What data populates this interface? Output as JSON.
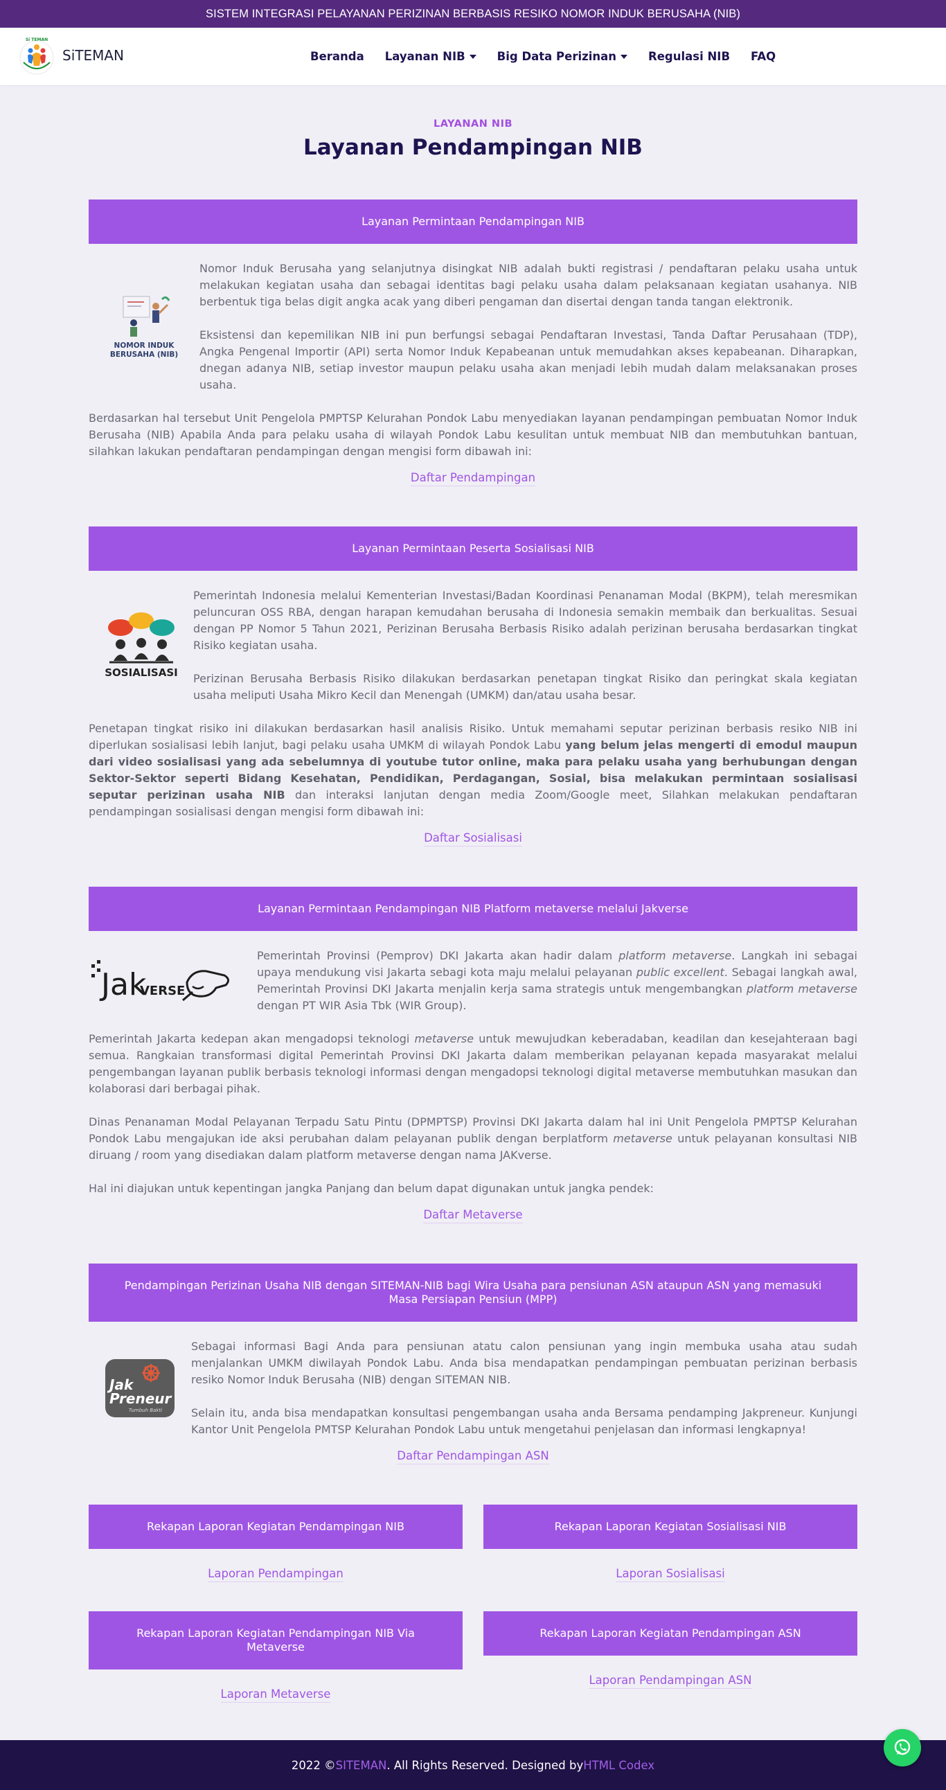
{
  "topbar": {
    "text": "SISTEM INTEGRASI PELAYANAN PERIZINAN BERBASIS RESIKO NOMOR INDUK BERUSAHA (NIB)"
  },
  "brand": {
    "name": "SiTEMAN",
    "logo_text": "Si TEMAN"
  },
  "nav": {
    "items": [
      {
        "label": "Beranda",
        "dropdown": false
      },
      {
        "label": "Layanan NIB",
        "dropdown": true
      },
      {
        "label": "Big Data Perizinan",
        "dropdown": true
      },
      {
        "label": "Regulasi NIB",
        "dropdown": false
      },
      {
        "label": "FAQ",
        "dropdown": false
      }
    ]
  },
  "header": {
    "eyebrow": "LAYANAN NIB",
    "title": "Layanan Pendampingan NIB"
  },
  "sections": {
    "nib": {
      "banner": "Layanan Permintaan Pendampingan NIB",
      "image_caption_1": "NOMOR INDUK",
      "image_caption_2": "BERUSAHA (NIB)",
      "p1": "Nomor Induk Berusaha yang selanjutnya disingkat NIB adalah bukti registrasi / pendaftaran pelaku usaha untuk melakukan kegiatan usaha dan sebagai identitas bagi pelaku usaha dalam pelaksanaan kegiatan usahanya. NIB berbentuk tiga belas digit angka acak yang diberi pengaman dan disertai dengan tanda tangan elektronik.",
      "p2": "Eksistensi dan kepemilikan NIB ini pun berfungsi sebagai Pendaftaran Investasi, Tanda Daftar Perusahaan (TDP), Angka Pengenal Importir (API) serta Nomor Induk Kepabeanan untuk memudahkan akses kepabeanan. Diharapkan, dnegan adanya NIB, setiap investor maupun pelaku usaha akan menjadi lebih mudah dalam melaksanakan proses usaha.",
      "p3": "Berdasarkan hal tersebut Unit Pengelola PMPTSP Kelurahan Pondok Labu menyediakan layanan pendampingan pembuatan Nomor Induk Berusaha (NIB) Apabila Anda para pelaku usaha di wilayah Pondok Labu kesulitan untuk membuat NIB dan membutuhkan bantuan, silahkan lakukan pendaftaran pendampingan dengan mengisi form dibawah ini:",
      "link": "Daftar Pendampingan"
    },
    "sosialisasi": {
      "banner": "Layanan Permintaan Peserta Sosialisasi NIB",
      "image_caption": "SOSIALISASI",
      "p1": "Pemerintah Indonesia melalui Kementerian Investasi/Badan Koordinasi Penanaman Modal (BKPM), telah meresmikan peluncuran OSS RBA, dengan harapan kemudahan berusaha di Indonesia semakin membaik dan berkualitas. Sesuai dengan PP Nomor 5 Tahun 2021, Perizinan Berusaha Berbasis Risiko adalah perizinan berusaha berdasarkan tingkat Risiko kegiatan usaha.",
      "p2": "Perizinan Berusaha Berbasis Risiko dilakukan berdasarkan penetapan tingkat Risiko dan peringkat skala kegiatan usaha meliputi Usaha Mikro Kecil dan Menengah (UMKM) dan/atau usaha besar.",
      "p3a": "Penetapan tingkat risiko ini dilakukan berdasarkan hasil analisis Risiko. Untuk memahami seputar perizinan berbasis resiko NIB ini diperlukan sosialisasi lebih lanjut, bagi pelaku usaha UMKM di wilayah Pondok Labu ",
      "p3b": "yang belum jelas mengerti di emodul maupun dari video sosialisasi yang ada sebelumnya di youtube tutor online, maka para pelaku usaha yang berhubungan dengan Sektor-Sektor seperti Bidang Kesehatan, Pendidikan, Perdagangan, Sosial, bisa melakukan permintaan sosialisasi seputar perizinan usaha NIB",
      "p3c": " dan interaksi lanjutan dengan media Zoom/Google meet, Silahkan melakukan pendaftaran pendampingan sosialisasi dengan mengisi form dibawah ini:",
      "link": "Daftar Sosialisasi"
    },
    "metaverse": {
      "banner": "Layanan Permintaan Pendampingan NIB Platform metaverse melalui Jakverse",
      "logo_text_a": "Jak",
      "logo_text_b": "VERSE",
      "p1a": "Pemerintah Provinsi (Pemprov) DKI Jakarta akan hadir dalam ",
      "p1b": "platform metaverse",
      "p1c": ". Langkah ini sebagai upaya mendukung visi Jakarta sebagi kota maju melalui pelayanan ",
      "p1d": "public excellent",
      "p1e": ". Sebagai langkah awal, Pemerintah Provinsi DKI Jakarta menjalin kerja sama strategis untuk mengembangkan ",
      "p1f": "platform metaverse",
      "p1g": " dengan PT WIR Asia Tbk (WIR Group).",
      "p2a": "Pemerintah Jakarta kedepan akan mengadopsi teknologi ",
      "p2b": "metaverse",
      "p2c": " untuk mewujudkan keberadaban, keadilan dan kesejahteraan bagi semua. Rangkaian transformasi digital Pemerintah Provinsi DKI Jakarta dalam memberikan pelayanan kepada masyarakat melalui pengembangan layanan publik berbasis teknologi informasi dengan mengadopsi teknologi digital metaverse membutuhkan masukan dan kolaborasi dari berbagai pihak.",
      "p3a": "Dinas Penanaman Modal Pelayanan Terpadu Satu Pintu (DPMPTSP) Provinsi DKI Jakarta dalam hal ini Unit Pengelola PMPTSP Kelurahan Pondok Labu mengajukan ide aksi perubahan dalam pelayanan publik dengan berplatform ",
      "p3b": "metaverse",
      "p3c": " untuk pelayanan konsultasi NIB diruang / room yang disediakan dalam platform metaverse dengan nama JAKverse.",
      "p4": "Hal ini diajukan untuk kepentingan jangka Panjang dan belum dapat digunakan untuk jangka pendek:",
      "link": "Daftar Metaverse"
    },
    "asn": {
      "banner": "Pendampingan Perizinan Usaha NIB dengan SITEMAN-NIB bagi Wira Usaha para pensiunan ASN ataupun ASN yang memasuki Masa Persiapan Pensiun (MPP)",
      "logo_text_a": "Jak",
      "logo_text_b": "Preneur",
      "logo_text_c": "Tumbuh Bakti",
      "p1": "Sebagai informasi Bagi Anda para pensiunan atatu calon pensiunan yang ingin membuka usaha atau sudah menjalankan UMKM diwilayah Pondok Labu. Anda bisa mendapatkan pendampingan pembuatan perizinan berbasis resiko Nomor Induk Berusaha (NIB) dengan SITEMAN NIB.",
      "p2": "Selain itu, anda bisa mendapatkan konsultasi pengembangan usaha anda Bersama pendamping Jakpreneur. Kunjungi Kantor Unit Pengelola PMTSP Kelurahan Pondok Labu untuk mengetahui penjelasan dan informasi lengkapnya!",
      "link": "Daftar Pendampingan ASN"
    }
  },
  "reports": [
    {
      "banner": "Rekapan Laporan Kegiatan Pendampingan NIB",
      "link": "Laporan Pendampingan"
    },
    {
      "banner": "Rekapan Laporan Kegiatan Sosialisasi NIB",
      "link": "Laporan Sosialisasi"
    },
    {
      "banner": "Rekapan Laporan Kegiatan Pendampingan NIB Via Metaverse",
      "link": "Laporan Metaverse"
    },
    {
      "banner": "Rekapan Laporan Kegiatan Pendampingan ASN",
      "link": "Laporan Pendampingan ASN"
    }
  ],
  "footer": {
    "prefix": "2022 © ",
    "brand": "SITEMAN",
    "middle": ". All Rights Reserved. Designed by ",
    "designer": "HTML Codex"
  },
  "colors": {
    "accent": "#9f55e4",
    "topbar": "#54297e",
    "navy": "#1e1450",
    "footer": "#1f1247",
    "whatsapp": "#25d366"
  },
  "icons": {
    "whatsapp": "whatsapp-icon"
  }
}
